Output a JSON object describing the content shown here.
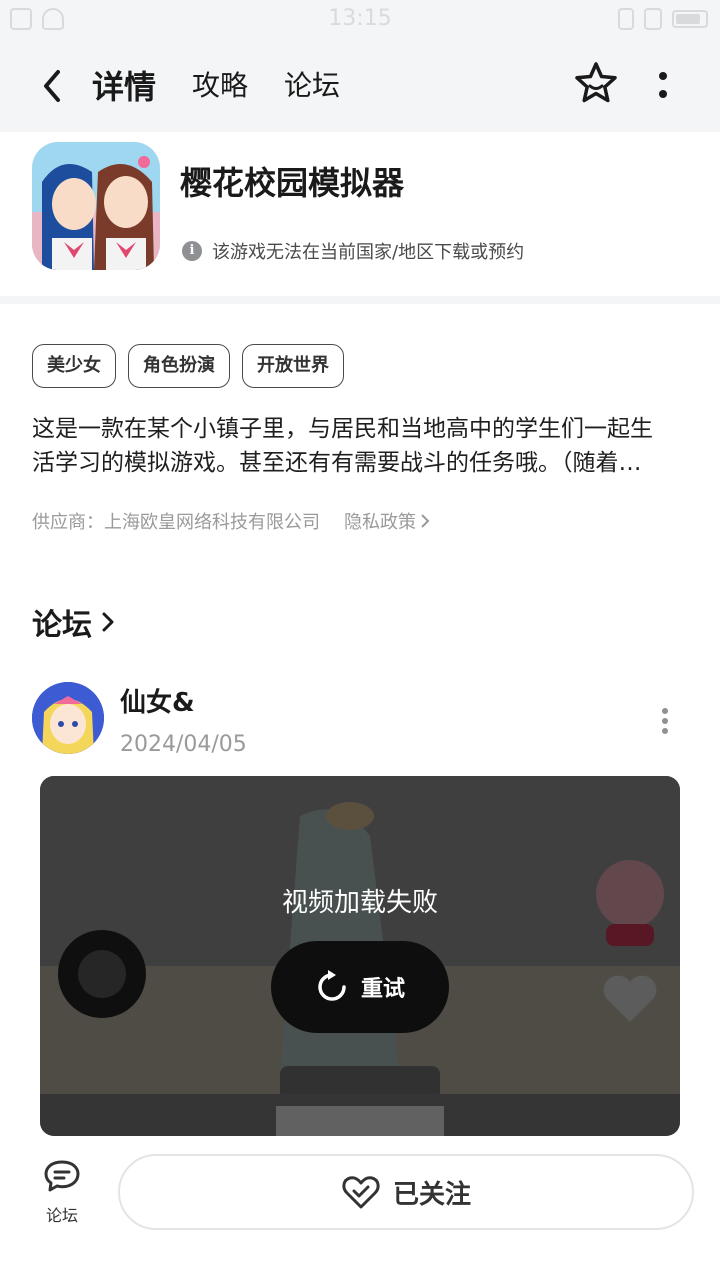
{
  "status_bar": {
    "time": "13:15"
  },
  "nav": {
    "tabs": [
      {
        "label": "详情",
        "active": true
      },
      {
        "label": "攻略",
        "active": false
      },
      {
        "label": "论坛",
        "active": false
      }
    ],
    "accent_color": "#15c5ce"
  },
  "app": {
    "title": "樱花校园模拟器",
    "notice": "该游戏无法在当前国家/地区下载或预约",
    "tags": [
      "美少女",
      "角色扮演",
      "开放世界"
    ],
    "description_line1": "这是一款在某个小镇子里，与居民和当地高中的学生们一起生",
    "description_line2": "活学习的模拟游戏。甚至还有有需要战斗的任务哦。（随着…",
    "supplier": "供应商：上海欧皇网络科技有限公司",
    "privacy": "隐私政策"
  },
  "forum": {
    "title": "论坛",
    "post": {
      "username": "仙女&",
      "date": "2024/04/05",
      "video_error": "视频加载失败",
      "retry_label": "重试"
    }
  },
  "bottom_bar": {
    "forum_label": "论坛",
    "follow_label": "已关注"
  },
  "icons": {
    "back": "chevron-left-icon",
    "star": "star-icon",
    "more": "more-vertical-icon",
    "info": "info-icon",
    "retry": "refresh-icon",
    "chat": "chat-bubble-icon",
    "heart": "heart-check-icon"
  }
}
